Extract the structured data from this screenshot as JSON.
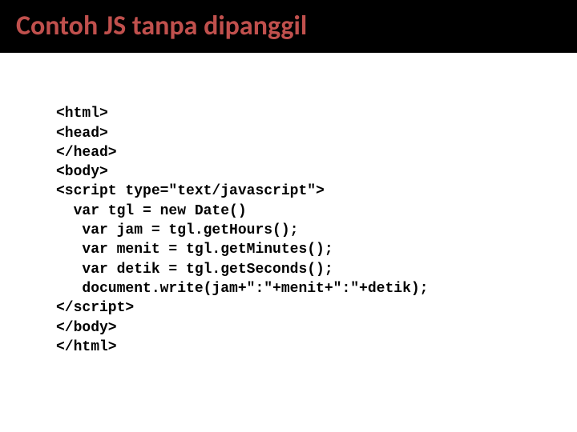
{
  "header": {
    "title": "Contoh JS tanpa dipanggil"
  },
  "code": {
    "lines": [
      "<html>",
      "<head>",
      "</head>",
      "<body>",
      "<script type=\"text/javascript\">",
      "  var tgl = new Date()",
      "   var jam = tgl.getHours();",
      "   var menit = tgl.getMinutes();",
      "   var detik = tgl.getSeconds();",
      "   document.write(jam+\":\"+menit+\":\"+detik);",
      "</script>",
      "</body>",
      "</html>"
    ]
  }
}
